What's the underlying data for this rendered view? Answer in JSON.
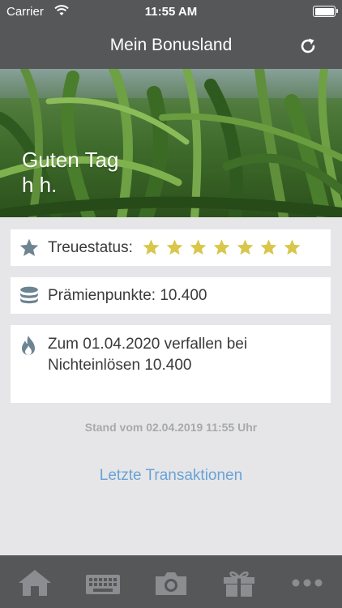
{
  "status_bar": {
    "carrier": "Carrier",
    "time": "11:55 AM"
  },
  "header": {
    "title": "Mein Bonusland"
  },
  "hero": {
    "greeting_line1": "Guten Tag",
    "greeting_line2": "h h."
  },
  "loyalty": {
    "label": "Treuestatus:",
    "stars": 7
  },
  "points": {
    "label": "Prämienpunkte: 10.400"
  },
  "expiry": {
    "line1": "Zum 01.04.2020 verfallen bei",
    "line2": "Nichteinlösen 10.400"
  },
  "stand": {
    "text": "Stand vom 02.04.2019  11:55 Uhr"
  },
  "transactions_link": {
    "label": "Letzte Transaktionen"
  },
  "tabbar": {
    "items": [
      "home-icon",
      "keyboard-icon",
      "camera-icon",
      "gift-icon",
      "more-icon"
    ]
  },
  "colors": {
    "bar": "#555759",
    "background": "#e6e6e8",
    "star": "#d8c74a",
    "link": "#6aa3d6",
    "icon": "#6d8492"
  }
}
